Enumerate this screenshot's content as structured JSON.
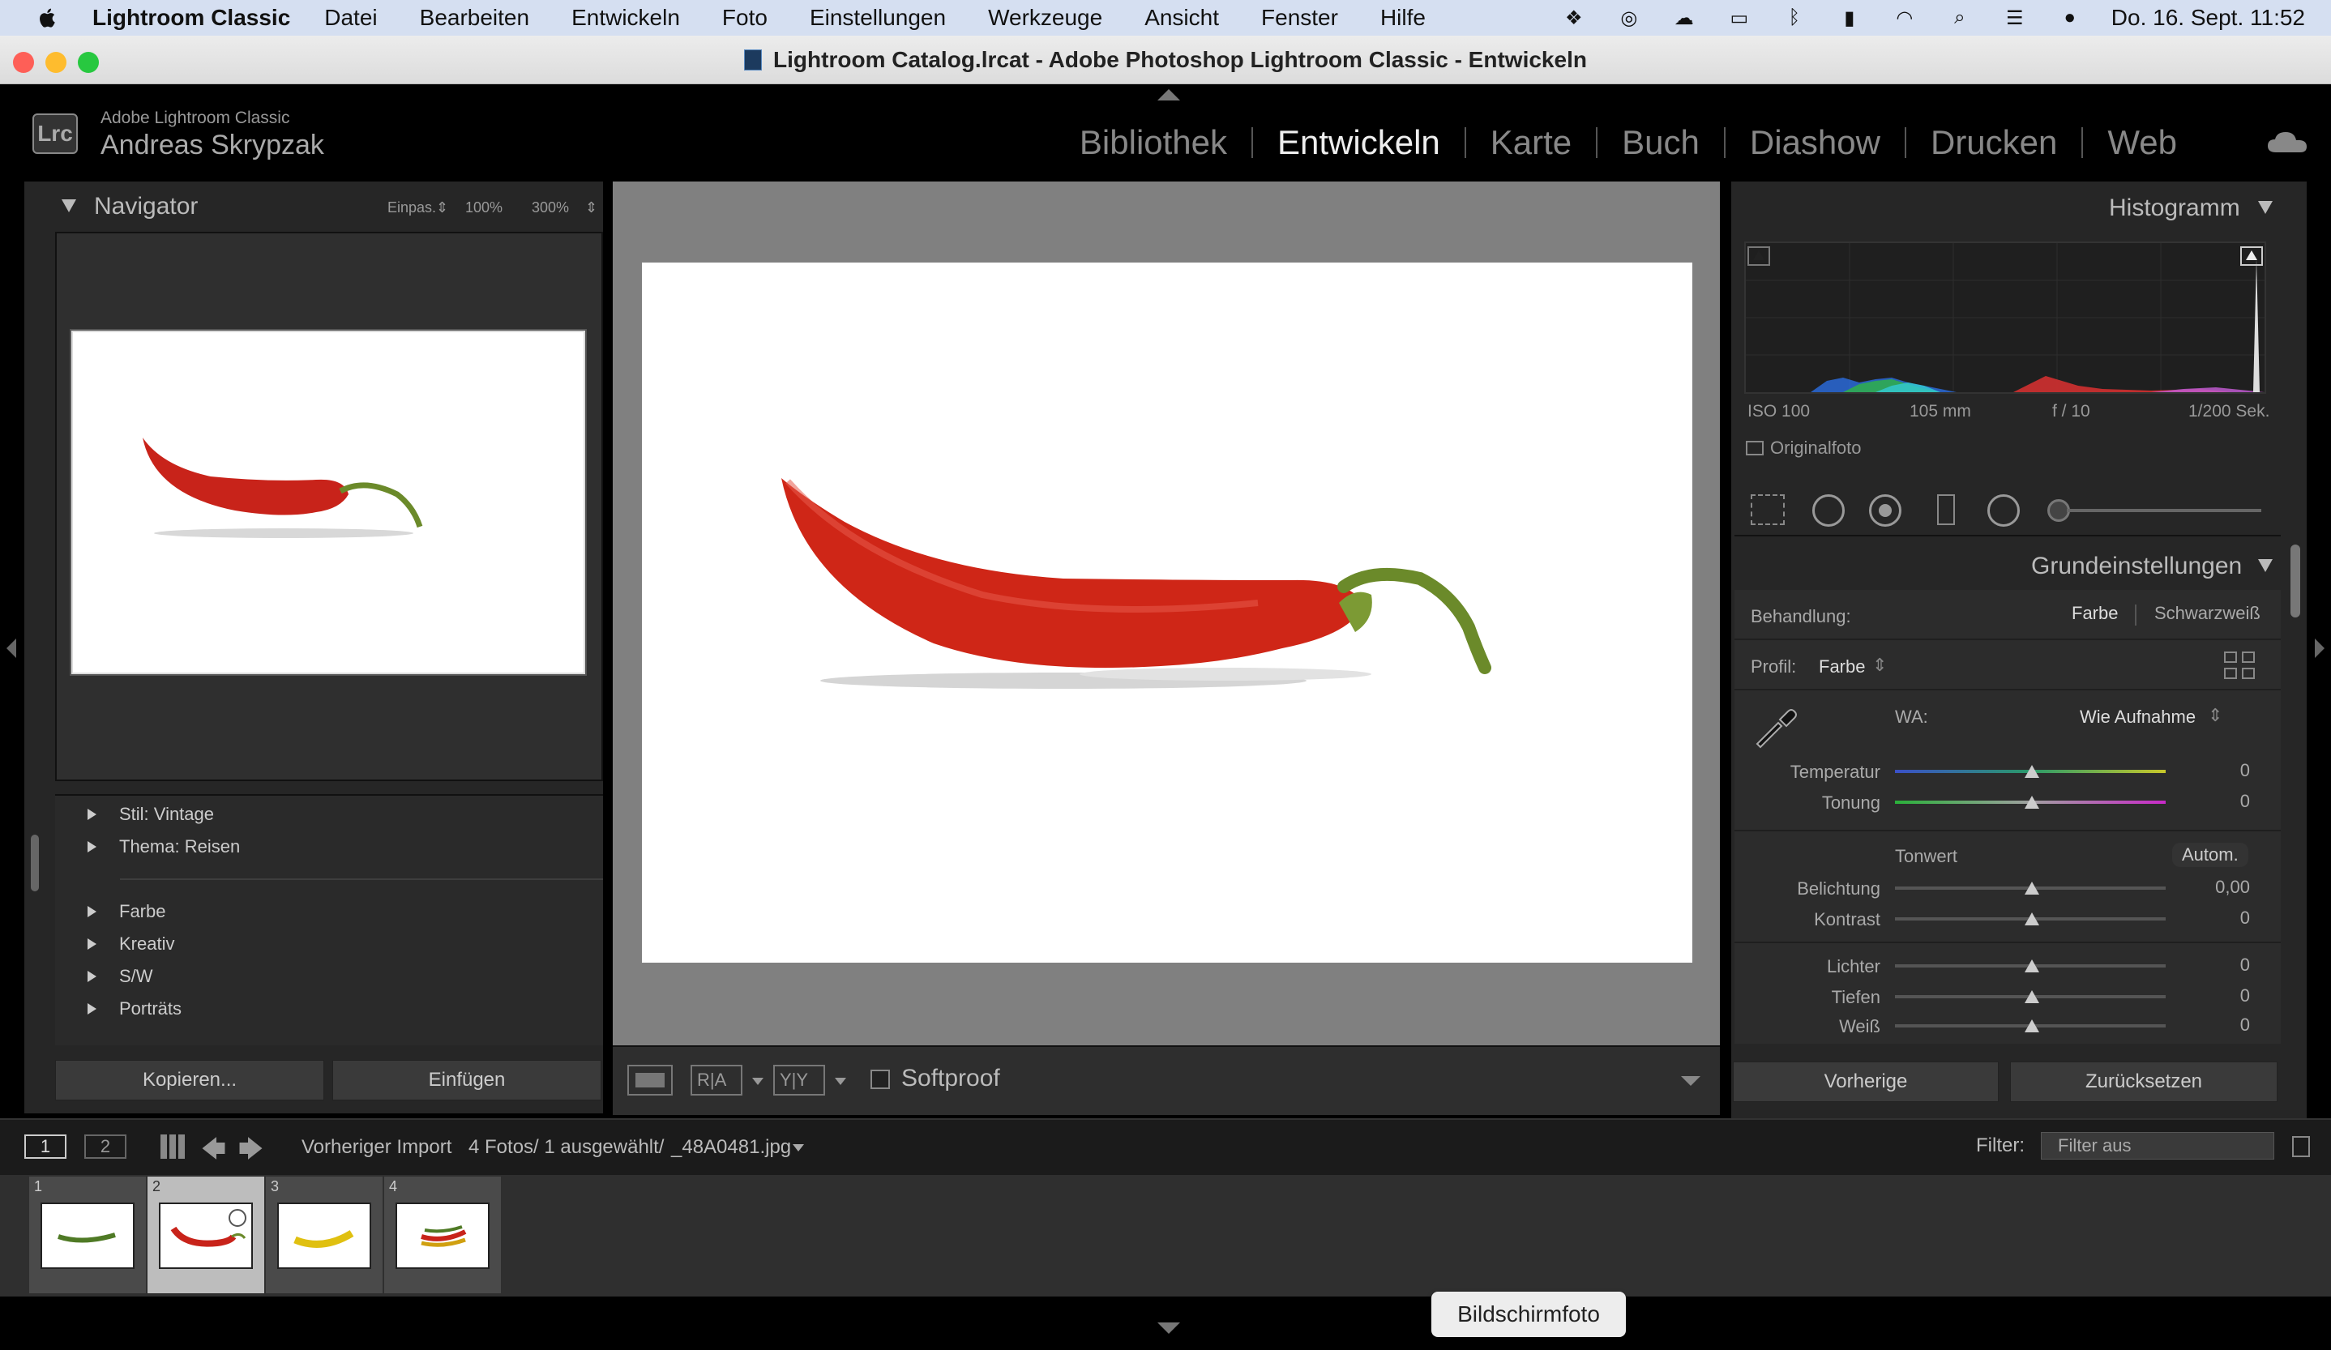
{
  "menubar": {
    "app_name": "Lightroom Classic",
    "items": [
      "Datei",
      "Bearbeiten",
      "Entwickeln",
      "Foto",
      "Einstellungen",
      "Werkzeuge",
      "Ansicht",
      "Fenster",
      "Hilfe"
    ],
    "clock": "Do. 16. Sept.  11:52",
    "status_icons": [
      "dropbox-icon",
      "creative-cloud-icon",
      "cloud-sync-icon",
      "card-icon",
      "bluetooth-icon",
      "battery-icon",
      "wifi-icon",
      "search-icon",
      "control-center-icon",
      "siri-icon"
    ]
  },
  "window": {
    "title": "Lightroom Catalog.lrcat - Adobe Photoshop Lightroom Classic - Entwickeln"
  },
  "identity": {
    "logo": "Lrc",
    "product": "Adobe Lightroom Classic",
    "user": "Andreas Skrypzak"
  },
  "modules": {
    "items": [
      "Bibliothek",
      "Entwickeln",
      "Karte",
      "Buch",
      "Diashow",
      "Drucken",
      "Web"
    ],
    "active": "Entwickeln"
  },
  "navigator": {
    "title": "Navigator",
    "zoom_fit": "Einpas.",
    "zoom_100": "100%",
    "zoom_300": "300%"
  },
  "presets": {
    "group1": [
      "Stil: Vintage",
      "Thema: Reisen"
    ],
    "group2": [
      "Farbe",
      "Kreativ",
      "S/W",
      "Porträts"
    ]
  },
  "left_buttons": {
    "copy": "Kopieren...",
    "paste": "Einfügen"
  },
  "toolbar": {
    "softproof": "Softproof",
    "ra_label": "R|A",
    "yy_label": "Y|Y"
  },
  "histogram": {
    "title": "Histogramm",
    "iso": "ISO 100",
    "focal": "105 mm",
    "aperture": "f / 10",
    "shutter": "1/200 Sek.",
    "original_photo": "Originalfoto"
  },
  "basic": {
    "title": "Grundeinstellungen",
    "treatment_label": "Behandlung:",
    "treatment_color": "Farbe",
    "treatment_bw": "Schwarzweiß",
    "profile_label": "Profil:",
    "profile_value": "Farbe",
    "wb_label": "WA:",
    "wb_value": "Wie Aufnahme",
    "temperature_label": "Temperatur",
    "temperature_value": "0",
    "tint_label": "Tonung",
    "tint_value": "0",
    "tone_label": "Tonwert",
    "auto_label": "Autom.",
    "exposure_label": "Belichtung",
    "exposure_value": "0,00",
    "contrast_label": "Kontrast",
    "contrast_value": "0",
    "highlights_label": "Lichter",
    "highlights_value": "0",
    "shadows_label": "Tiefen",
    "shadows_value": "0",
    "whites_label": "Weiß",
    "whites_value": "0"
  },
  "right_buttons": {
    "previous": "Vorherige",
    "reset": "Zurücksetzen"
  },
  "filmstrip_bar": {
    "screen1": "1",
    "screen2": "2",
    "source": "Vorheriger Import",
    "count": "4 Fotos/ 1 ausgewählt/",
    "filename": "_48A0481.jpg",
    "filter_label": "Filter:",
    "filter_value": "Filter aus"
  },
  "thumbnails": [
    {
      "num": "1",
      "selected": false
    },
    {
      "num": "2",
      "selected": true
    },
    {
      "num": "3",
      "selected": false
    },
    {
      "num": "4",
      "selected": false
    }
  ],
  "tooltip": "Bildschirmfoto",
  "colors": {
    "active_module": "#eeeeee",
    "inactive_module": "#888888",
    "panel_bg": "#262626",
    "chili_red": "#d42a1a",
    "stem_green": "#6b8a2a"
  }
}
